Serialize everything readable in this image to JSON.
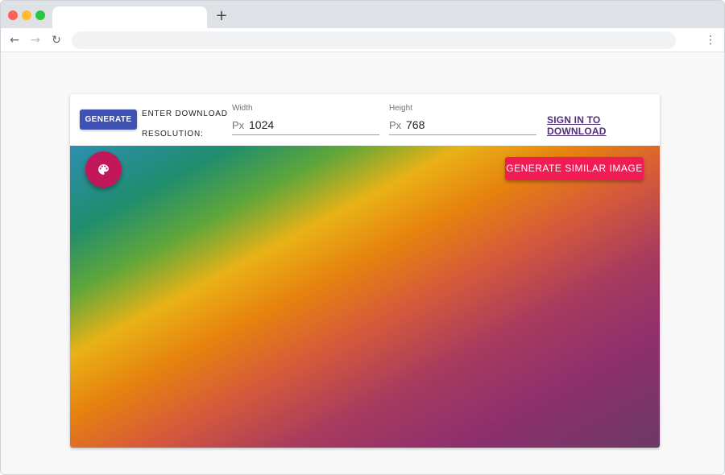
{
  "browser": {
    "new_tab_glyph": "+",
    "back_glyph": "←",
    "forward_glyph": "→",
    "reload_glyph": "↻",
    "menu_glyph": "⋮"
  },
  "controls": {
    "generate_label": "GENERATE",
    "resolution_line1": "ENTER DOWNLOAD",
    "resolution_line2": "RESOLUTION:",
    "width": {
      "label": "Width",
      "prefix": "Px",
      "value": "1024"
    },
    "height": {
      "label": "Height",
      "prefix": "Px",
      "value": "768"
    },
    "signin_label": "SIGN IN TO DOWNLOAD"
  },
  "canvas": {
    "palette_icon": "palette-icon",
    "similar_label": "GENERATE SIMILAR IMAGE"
  },
  "colors": {
    "generate_button": "#3f51b5",
    "palette_fab": "#c2185b",
    "similar_button": "#f21c55",
    "signin_link": "#512f7c"
  }
}
